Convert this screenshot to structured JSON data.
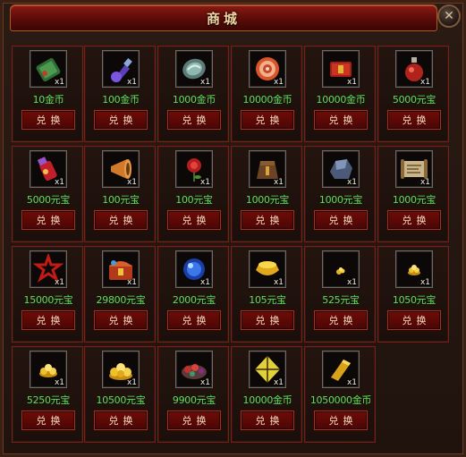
{
  "window": {
    "title": "商城",
    "close_icon": "close-x-icon"
  },
  "items": [
    {
      "icon": "green-scroll-icon",
      "qty": "x1",
      "price": "10金币",
      "btn": "兑换"
    },
    {
      "icon": "blue-potion-icon",
      "qty": "x1",
      "price": "100金币",
      "btn": "兑换"
    },
    {
      "icon": "jade-stone-icon",
      "qty": "x1",
      "price": "1000金币",
      "btn": "兑换"
    },
    {
      "icon": "swirl-orb-icon",
      "qty": "x1",
      "price": "10000金币",
      "btn": "兑换"
    },
    {
      "icon": "red-book-icon",
      "qty": "x1",
      "price": "10000金币",
      "btn": "兑换"
    },
    {
      "icon": "red-flask-icon",
      "qty": "x1",
      "price": "5000元宝",
      "btn": "兑换"
    },
    {
      "icon": "magic-bottle-icon",
      "qty": "x1",
      "price": "5000元宝",
      "btn": "兑换"
    },
    {
      "icon": "horn-icon",
      "qty": "x1",
      "price": "100元宝",
      "btn": "兑换"
    },
    {
      "icon": "red-rose-icon",
      "qty": "x1",
      "price": "100元宝",
      "btn": "兑换"
    },
    {
      "icon": "leather-pouch-icon",
      "qty": "x1",
      "price": "1000元宝",
      "btn": "兑换"
    },
    {
      "icon": "ore-chunk-icon",
      "qty": "x1",
      "price": "1000元宝",
      "btn": "兑换"
    },
    {
      "icon": "map-scroll-icon",
      "qty": "x1",
      "price": "1000元宝",
      "btn": "兑换"
    },
    {
      "icon": "red-rune-icon",
      "qty": "x1",
      "price": "15000元宝",
      "btn": "兑换"
    },
    {
      "icon": "treasure-chest-icon",
      "qty": "x1",
      "price": "29800元宝",
      "btn": "兑换"
    },
    {
      "icon": "blue-gem-icon",
      "qty": "x1",
      "price": "2000元宝",
      "btn": "兑换"
    },
    {
      "icon": "gold-ingot-icon",
      "qty": "x1",
      "price": "105元宝",
      "btn": "兑换"
    },
    {
      "icon": "gold-nugget-small-icon",
      "qty": "x1",
      "price": "525元宝",
      "btn": "兑换"
    },
    {
      "icon": "gold-pile-small-icon",
      "qty": "x1",
      "price": "1050元宝",
      "btn": "兑换"
    },
    {
      "icon": "gold-pile-medium-icon",
      "qty": "x1",
      "price": "5250元宝",
      "btn": "兑换"
    },
    {
      "icon": "gold-pile-large-icon",
      "qty": "x1",
      "price": "10500元宝",
      "btn": "兑换"
    },
    {
      "icon": "jewel-cluster-icon",
      "qty": "x1",
      "price": "9900元宝",
      "btn": "兑换"
    },
    {
      "icon": "kite-icon",
      "qty": "x1",
      "price": "10000金币",
      "btn": "兑换"
    },
    {
      "icon": "gold-bar-icon",
      "qty": "x1",
      "price": "1050000金币",
      "btn": "兑换"
    }
  ]
}
